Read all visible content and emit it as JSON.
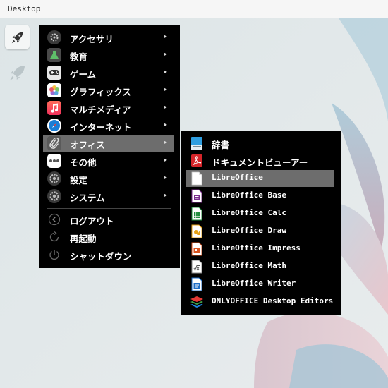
{
  "titlebar": {
    "title": "Desktop"
  },
  "main_menu": {
    "items": [
      {
        "label": "アクセサリ",
        "icon": "accessories-icon",
        "submenu": true
      },
      {
        "label": "教育",
        "icon": "education-icon",
        "submenu": true
      },
      {
        "label": "ゲーム",
        "icon": "games-icon",
        "submenu": true
      },
      {
        "label": "グラフィックス",
        "icon": "graphics-icon",
        "submenu": true
      },
      {
        "label": "マルチメディア",
        "icon": "multimedia-icon",
        "submenu": true
      },
      {
        "label": "インターネット",
        "icon": "internet-icon",
        "submenu": true
      },
      {
        "label": "オフィス",
        "icon": "office-icon",
        "submenu": true,
        "active": true
      },
      {
        "label": "その他",
        "icon": "other-icon",
        "submenu": true
      },
      {
        "label": "設定",
        "icon": "settings-icon",
        "submenu": true
      },
      {
        "label": "システム",
        "icon": "system-icon",
        "submenu": true
      },
      {
        "label": "ログアウト",
        "icon": "logout-icon"
      },
      {
        "label": "再起動",
        "icon": "restart-icon"
      },
      {
        "label": "シャットダウン",
        "icon": "shutdown-icon"
      }
    ],
    "arrow": "▸"
  },
  "office_submenu": {
    "items": [
      {
        "label": "辞書",
        "icon": "dictionary-icon"
      },
      {
        "label": "ドキュメントビューアー",
        "icon": "document-viewer-icon"
      },
      {
        "label": "LibreOffice",
        "icon": "libreoffice-icon",
        "active": true
      },
      {
        "label": "LibreOffice Base",
        "icon": "libreoffice-base-icon"
      },
      {
        "label": "LibreOffice Calc",
        "icon": "libreoffice-calc-icon"
      },
      {
        "label": "LibreOffice Draw",
        "icon": "libreoffice-draw-icon"
      },
      {
        "label": "LibreOffice Impress",
        "icon": "libreoffice-impress-icon"
      },
      {
        "label": "LibreOffice Math",
        "icon": "libreoffice-math-icon"
      },
      {
        "label": "LibreOffice Writer",
        "icon": "libreoffice-writer-icon"
      },
      {
        "label": "ONLYOFFICE Desktop Editors",
        "icon": "onlyoffice-icon"
      }
    ]
  },
  "colors": {
    "menu_bg": "#000000",
    "highlight": "#6d6d6d",
    "base": "#7b2d8e",
    "calc": "#1e8c3a",
    "draw": "#e8a317",
    "impress": "#d9531e",
    "writer": "#1e6ec8"
  }
}
